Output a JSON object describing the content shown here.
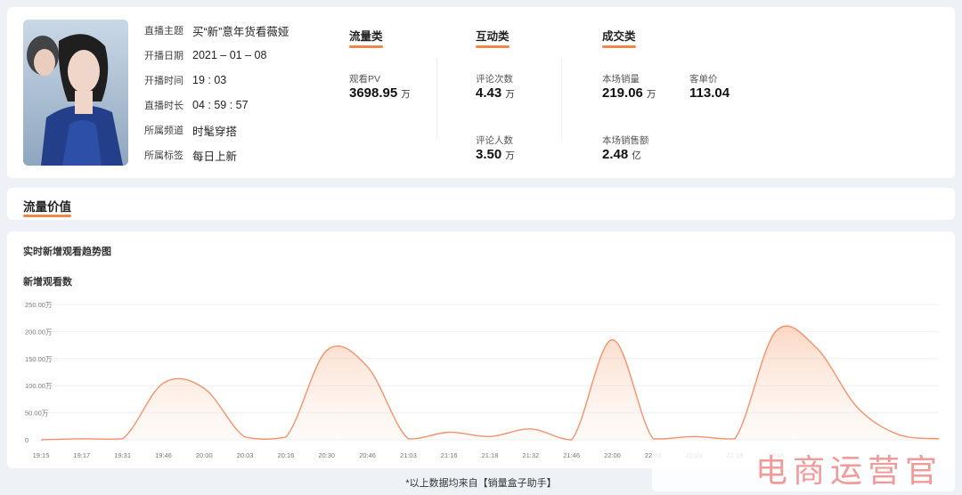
{
  "stream_info": {
    "items": [
      {
        "label": "直播主题",
        "value": "买“新”意年货看薇娅"
      },
      {
        "label": "开播日期",
        "value": "2021 – 01 – 08"
      },
      {
        "label": "开播时间",
        "value": "19 : 03"
      },
      {
        "label": "直播时长",
        "value": "04 : 59 : 57"
      },
      {
        "label": "所属频道",
        "value": "时髦穿搭"
      },
      {
        "label": "所属标签",
        "value": "每日上新"
      }
    ]
  },
  "sections": {
    "traffic": {
      "title": "流量类",
      "metrics": [
        {
          "label": "观看PV",
          "value": "3698.95",
          "unit": "万"
        }
      ]
    },
    "interaction": {
      "title": "互动类",
      "metrics": [
        {
          "label": "评论次数",
          "value": "4.43",
          "unit": "万"
        },
        {
          "label": "评论人数",
          "value": "3.50",
          "unit": "万"
        }
      ]
    },
    "deal": {
      "title": "成交类",
      "metrics": [
        {
          "label": "本场销量",
          "value": "219.06",
          "unit": "万"
        },
        {
          "label": "客单价",
          "value": "113.04",
          "unit": ""
        },
        {
          "label": "本场销售额",
          "value": "2.48",
          "unit": "亿"
        }
      ]
    }
  },
  "traffic_value": {
    "title": "流量价值"
  },
  "chart_section": {
    "title": "实时新增观看趋势图",
    "ylabel": "新增观看数"
  },
  "colors": {
    "accent": "#f0874a",
    "line": "#f2936a"
  },
  "chart_data": {
    "type": "area",
    "x": [
      "19:15",
      "19:17",
      "19:31",
      "19:46",
      "20:00",
      "20:03",
      "20:16",
      "20:30",
      "20:46",
      "21:03",
      "21:16",
      "21:18",
      "21:32",
      "21:46",
      "22:00",
      "22:01",
      "22:03",
      "22:18",
      "22:48"
    ],
    "y_ticks": [
      "0",
      "50.00万",
      "100.00万",
      "150.00万",
      "200.00万",
      "250.00万"
    ],
    "ylim": [
      0,
      250
    ],
    "y_unit": "万",
    "values": [
      0,
      2,
      2,
      105,
      95,
      5,
      5,
      165,
      135,
      2,
      14,
      6,
      20,
      0,
      185,
      2,
      6,
      2,
      200
    ],
    "tail": [
      170,
      60,
      10,
      2
    ],
    "grid": true
  },
  "footnote": "*以上数据均来自【销量盒子助手】",
  "watermark": "电商运营官"
}
